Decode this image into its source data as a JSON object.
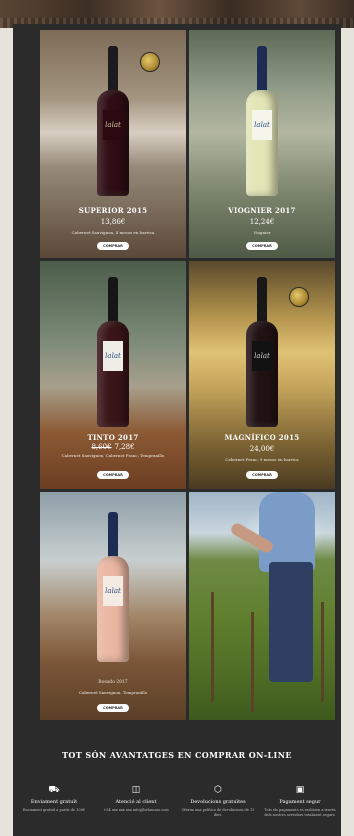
{
  "products": [
    {
      "name": "SUPERIOR 2015",
      "price": "13,86€",
      "old_price": "",
      "description": "Cabernet Sauvignon, 4 mesos en barrica",
      "button": "COMPRAR",
      "label": "lalat"
    },
    {
      "name": "VIOGNIER 2017",
      "price": "12,24€",
      "old_price": "",
      "description": "Viognier",
      "button": "COMPRAR",
      "label": "lalat"
    },
    {
      "name": "TINTO 2017",
      "price": "7,28€",
      "old_price": "8,60€",
      "description": "Cabernet Sauvignon, Cabernet Franc, Tempranillo",
      "button": "COMPRAR",
      "label": "lalat"
    },
    {
      "name": "MAGNÍFICO 2015",
      "price": "24,00€",
      "old_price": "",
      "description": "Cabernet Franc, 9 mesos en barrica",
      "button": "COMPRAR",
      "label": "lalat"
    },
    {
      "name": "Rosado 2017",
      "price": "",
      "old_price": "",
      "description": "Cabernet Sauvignon, Tempranillo",
      "button": "COMPRAR",
      "label": "lalat"
    }
  ],
  "advantages": {
    "title": "TOT SÓN AVANTATGES EN COMPRAR ON-LINE",
    "items": [
      {
        "icon": "truck-icon",
        "title": "Enviament gratuït",
        "desc": "Enviament gratuït a partir de 100€"
      },
      {
        "icon": "bag-icon",
        "title": "Atenció al client",
        "desc": "+34 xxx xxx xxx info@lerlamars.com"
      },
      {
        "icon": "box-icon",
        "title": "Devolucions gratuïtes",
        "desc": "Oferim una política de devolucions de 15 dies."
      },
      {
        "icon": "lock-icon",
        "title": "Pagament segur",
        "desc": "Tots els pagaments es realitzen a través dels nostres servidors totalment segurs."
      }
    ]
  }
}
